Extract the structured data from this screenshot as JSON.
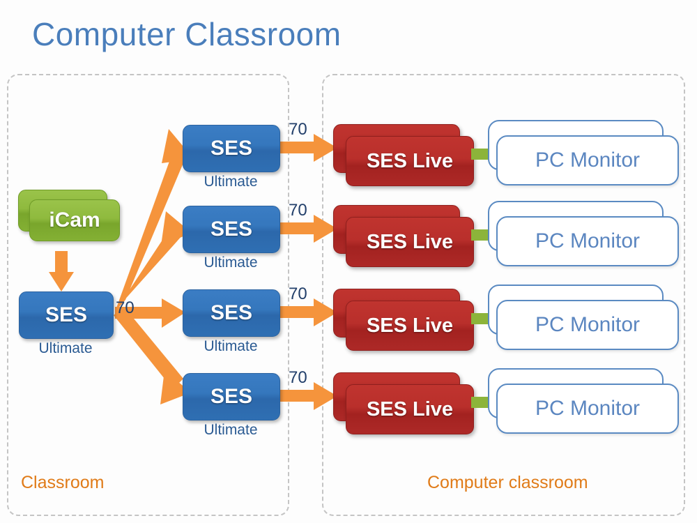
{
  "title": "Computer Classroom",
  "colors": {
    "title_blue": "#4a7ebb",
    "panel_border": "#c4c4c4",
    "panel_label_orange": "#e07b18",
    "arrow_orange": "#f5943c",
    "ses_blue": "#3577bd",
    "icam_green": "#8fba3e",
    "live_red": "#b92f2b",
    "monitor_border": "#5a8ac2",
    "monitor_text": "#5b86c0",
    "green_link": "#8cb43a",
    "bandwidth_text": "#23406b"
  },
  "panels": [
    {
      "id": "classroom",
      "label": "Classroom"
    },
    {
      "id": "computer-classroom",
      "label": "Computer classroom"
    }
  ],
  "source": {
    "camera": {
      "label": "iCam"
    },
    "server": {
      "label": "SES",
      "sublabel": "Ultimate"
    },
    "hub_bandwidth": "70"
  },
  "rows": [
    {
      "relay": {
        "label": "SES",
        "sublabel": "Ultimate"
      },
      "bandwidth": "70",
      "live": {
        "label": "SES Live"
      },
      "monitor": {
        "label": "PC Monitor"
      }
    },
    {
      "relay": {
        "label": "SES",
        "sublabel": "Ultimate"
      },
      "bandwidth": "70",
      "live": {
        "label": "SES Live"
      },
      "monitor": {
        "label": "PC Monitor"
      }
    },
    {
      "relay": {
        "label": "SES",
        "sublabel": "Ultimate"
      },
      "bandwidth": "70",
      "live": {
        "label": "SES Live"
      },
      "monitor": {
        "label": "PC Monitor"
      }
    },
    {
      "relay": {
        "label": "SES",
        "sublabel": "Ultimate"
      },
      "bandwidth": "70",
      "live": {
        "label": "SES Live"
      },
      "monitor": {
        "label": "PC Monitor"
      }
    }
  ]
}
